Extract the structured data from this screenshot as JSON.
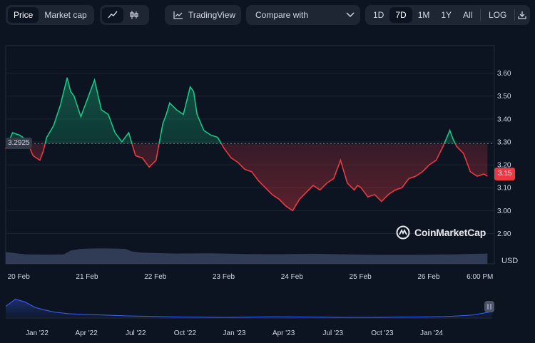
{
  "toolbar": {
    "view_tabs": [
      {
        "label": "Price",
        "active": true
      },
      {
        "label": "Market cap",
        "active": false
      }
    ],
    "chart_type_icons": [
      "line-chart-icon",
      "candlestick-icon"
    ],
    "tradingview_label": "TradingView",
    "compare_label": "Compare with",
    "range_tabs": [
      {
        "label": "1D",
        "active": false
      },
      {
        "label": "7D",
        "active": true
      },
      {
        "label": "1M",
        "active": false
      },
      {
        "label": "1Y",
        "active": false
      },
      {
        "label": "All",
        "active": false
      }
    ],
    "log_label": "LOG",
    "download_icon": "download-icon"
  },
  "chart": {
    "start_price_label": "3.2925",
    "current_price_label": "3.15",
    "currency_label": "USD",
    "watermark": "CoinMarketCap"
  },
  "colors": {
    "background": "#0d1421",
    "up": "#16c784",
    "down": "#ea3943",
    "volume": "#3a4663",
    "navigator": "#3861fb"
  },
  "chart_data": {
    "type": "line",
    "title": "",
    "ylabel": "USD",
    "ylim": [
      2.83,
      3.72
    ],
    "yticks": [
      2.9,
      3.0,
      3.1,
      3.2,
      3.3,
      3.4,
      3.5,
      3.6
    ],
    "ytick_labels": [
      "2.90",
      "3.00",
      "3.10",
      "3.20",
      "3.30",
      "3.40",
      "3.50",
      "3.60"
    ],
    "xlim": [
      0,
      7.12
    ],
    "xticks": [
      0.19,
      1.19,
      2.19,
      3.19,
      4.19,
      5.19,
      6.19,
      6.94
    ],
    "xtick_labels": [
      "20 Feb",
      "21 Feb",
      "22 Feb",
      "23 Feb",
      "24 Feb",
      "25 Feb",
      "26 Feb",
      "6:00 PM"
    ],
    "baseline": 3.2925,
    "price": {
      "x": [
        0,
        0.1,
        0.2,
        0.3,
        0.4,
        0.5,
        0.55,
        0.6,
        0.7,
        0.8,
        0.9,
        0.95,
        1.0,
        1.1,
        1.2,
        1.3,
        1.4,
        1.5,
        1.6,
        1.7,
        1.8,
        1.9,
        2.0,
        2.1,
        2.2,
        2.3,
        2.35,
        2.4,
        2.5,
        2.6,
        2.7,
        2.75,
        2.8,
        2.9,
        3.0,
        3.1,
        3.2,
        3.3,
        3.4,
        3.5,
        3.6,
        3.7,
        3.8,
        3.9,
        4.0,
        4.1,
        4.2,
        4.3,
        4.4,
        4.5,
        4.6,
        4.7,
        4.8,
        4.9,
        5.0,
        5.1,
        5.15,
        5.2,
        5.3,
        5.4,
        5.5,
        5.6,
        5.7,
        5.8,
        5.9,
        6.0,
        6.1,
        6.2,
        6.3,
        6.4,
        6.5,
        6.55,
        6.6,
        6.7,
        6.8,
        6.9,
        7.0,
        7.05
      ],
      "y": [
        3.27,
        3.34,
        3.33,
        3.31,
        3.24,
        3.22,
        3.26,
        3.32,
        3.37,
        3.46,
        3.58,
        3.52,
        3.5,
        3.41,
        3.49,
        3.57,
        3.44,
        3.42,
        3.34,
        3.3,
        3.34,
        3.24,
        3.23,
        3.19,
        3.22,
        3.38,
        3.42,
        3.47,
        3.44,
        3.42,
        3.54,
        3.52,
        3.42,
        3.35,
        3.33,
        3.32,
        3.27,
        3.23,
        3.21,
        3.18,
        3.17,
        3.13,
        3.1,
        3.07,
        3.05,
        3.02,
        3.0,
        3.05,
        3.08,
        3.11,
        3.09,
        3.12,
        3.14,
        3.22,
        3.12,
        3.09,
        3.11,
        3.1,
        3.06,
        3.07,
        3.04,
        3.07,
        3.09,
        3.1,
        3.14,
        3.15,
        3.17,
        3.2,
        3.22,
        3.28,
        3.35,
        3.31,
        3.28,
        3.25,
        3.17,
        3.15,
        3.16,
        3.15
      ]
    },
    "volume": {
      "x": [
        0,
        0.3,
        0.6,
        0.85,
        0.95,
        1.1,
        1.3,
        1.5,
        1.75,
        1.85,
        2.0,
        2.5,
        3.0,
        3.5,
        4.0,
        4.5,
        5.0,
        5.5,
        6.0,
        6.5,
        6.9,
        7.05
      ],
      "v": [
        0.55,
        0.44,
        0.43,
        0.44,
        0.62,
        0.7,
        0.72,
        0.72,
        0.7,
        0.58,
        0.52,
        0.48,
        0.49,
        0.46,
        0.45,
        0.47,
        0.44,
        0.42,
        0.42,
        0.44,
        0.47,
        0.48
      ]
    },
    "navigator": {
      "xtick_labels": [
        "Jan '22",
        "Apr '22",
        "Jul '22",
        "Oct '22",
        "Jan '23",
        "Apr '23",
        "Jul '23",
        "Oct '23",
        "Jan '24"
      ],
      "x": [
        0,
        0.02,
        0.04,
        0.06,
        0.08,
        0.1,
        0.13,
        0.16,
        0.2,
        0.25,
        0.3,
        0.35,
        0.4,
        0.45,
        0.5,
        0.55,
        0.6,
        0.65,
        0.7,
        0.75,
        0.8,
        0.85,
        0.9,
        0.93,
        0.96,
        0.98,
        1.0
      ],
      "y": [
        0.55,
        0.88,
        0.75,
        0.5,
        0.38,
        0.28,
        0.2,
        0.17,
        0.14,
        0.1,
        0.08,
        0.05,
        0.04,
        0.03,
        0.04,
        0.06,
        0.05,
        0.04,
        0.03,
        0.03,
        0.04,
        0.05,
        0.07,
        0.1,
        0.14,
        0.22,
        0.3
      ]
    }
  }
}
